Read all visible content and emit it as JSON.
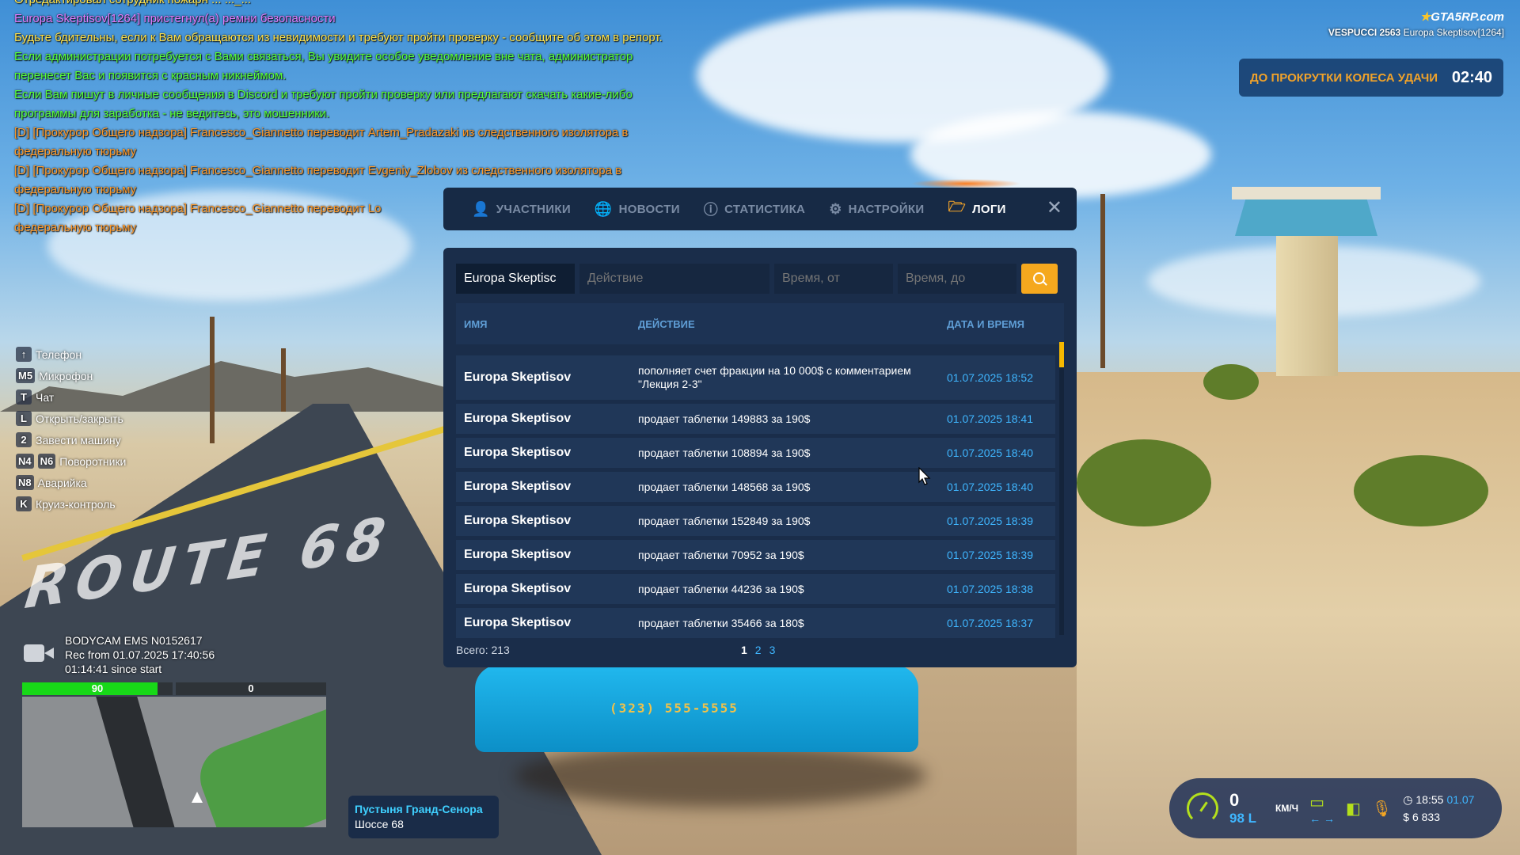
{
  "chat": [
    {
      "text": "Отредактировал сотрудник пожарн ... ..._...",
      "color": "c-yellow",
      "cut": true
    },
    {
      "text": "Europa Skeptisov[1264] пристегнул(а) ремни безопасности",
      "color": "c-purple"
    },
    {
      "text": "Будьте бдительны, если к Вам обращаются из невидимости и требуют пройти проверку - сообщите об этом в репорт.",
      "color": "c-yellow"
    },
    {
      "text": "Если администрации потребуется с Вами связаться, Вы увидите особое уведомление вне чата, администратор",
      "color": "c-green"
    },
    {
      "text": "перенесет Вас и появится с красным никнеймом.",
      "color": "c-green"
    },
    {
      "text": "Если Вам пишут в личные сообщения в Discord и требуют пройти проверку или предлагают скачать какие-либо",
      "color": "c-green"
    },
    {
      "text": "программы для заработка - не ведитесь, это мошенники.",
      "color": "c-green"
    },
    {
      "text": "[D] [Прокурор Общего надзора] Francesco_Giannetto переводит Artem_Pradazaki из следственного изолятора в",
      "color": "c-orange"
    },
    {
      "text": "федеральную тюрьму",
      "color": "c-orange"
    },
    {
      "text": "[D] [Прокурор Общего надзора] Francesco_Giannetto переводит Evgeniy_Zlobov из следственного изолятора в",
      "color": "c-orange"
    },
    {
      "text": "федеральную тюрьму",
      "color": "c-orange"
    },
    {
      "text": "[D] [Прокурор Общего надзора] Francesco_Giannetto переводит Lo",
      "color": "c-orange"
    },
    {
      "text": "федеральную тюрьму",
      "color": "c-orange"
    }
  ],
  "brand": {
    "logo": "GTA5RP.com",
    "server": "VESPUCCI 2563",
    "player": "Europa Skeptisov[1264]"
  },
  "wheel": {
    "label": "ДО ПРОКРУТКИ КОЛЕСА УДАЧИ",
    "time": "02:40"
  },
  "hints": [
    {
      "key": "↑",
      "label": "Телефон"
    },
    {
      "key": "M5",
      "label": "Микрофон"
    },
    {
      "key": "T",
      "label": "Чат"
    },
    {
      "key": "L",
      "label": "Открыть/закрыть"
    },
    {
      "key": "2",
      "label": "Завести машину"
    },
    {
      "key": "N4",
      "key2": "N6",
      "label": "Поворотники"
    },
    {
      "key": "N8",
      "label": "Аварийка"
    },
    {
      "key": "K",
      "label": "Круиз-контроль"
    }
  ],
  "bodycam": {
    "id": "BODYCAM EMS N0152617",
    "rec": "Rec from 01.07.2025 17:40:56",
    "since": "01:14:41 since start"
  },
  "bars": {
    "health": "90",
    "health_fraction": 0.9,
    "armor": "0",
    "armor_fraction": 0
  },
  "location": {
    "zone": "Пустыня Гранд-Сенора",
    "street": "Шоссе 68"
  },
  "hud": {
    "speed": "0",
    "fuel": "98 L",
    "unit": "КМ/Ч",
    "time": "18:55",
    "date": "01.07",
    "money": "6 833"
  },
  "tabs": [
    {
      "label": "УЧАСТНИКИ",
      "icon": "user-icon",
      "glyph": "👤",
      "active": false
    },
    {
      "label": "НОВОСТИ",
      "icon": "globe-icon",
      "glyph": "🌐",
      "active": false
    },
    {
      "label": "СТАТИСТИКА",
      "icon": "info-icon",
      "glyph": "ⓘ",
      "active": false
    },
    {
      "label": "НАСТРОЙКИ",
      "icon": "gear-icon",
      "glyph": "⚙",
      "active": false
    },
    {
      "label": "ЛОГИ",
      "icon": "folder-icon",
      "glyph": "🗁",
      "active": true
    }
  ],
  "filters": {
    "name_value": "Europa Skeptisc",
    "action_placeholder": "Действие",
    "from_placeholder": "Время, от",
    "to_placeholder": "Время, до"
  },
  "table": {
    "headers": {
      "name": "ИМЯ",
      "action": "ДЕЙСТВИЕ",
      "date": "ДАТА И ВРЕМЯ"
    },
    "rows": [
      {
        "name": "Europa Skeptisov",
        "action": "пополняет счет фракции на 10 000$ с комментарием \"Лекция 2-3\"",
        "date": "01.07.2025 18:52",
        "tall": true
      },
      {
        "name": "Europa Skeptisov",
        "action": "продает таблетки 149883 за 190$",
        "date": "01.07.2025 18:41"
      },
      {
        "name": "Europa Skeptisov",
        "action": "продает таблетки 108894 за 190$",
        "date": "01.07.2025 18:40"
      },
      {
        "name": "Europa Skeptisov",
        "action": "продает таблетки 148568 за 190$",
        "date": "01.07.2025 18:40"
      },
      {
        "name": "Europa Skeptisov",
        "action": "продает таблетки 152849 за 190$",
        "date": "01.07.2025 18:39"
      },
      {
        "name": "Europa Skeptisov",
        "action": "продает таблетки 70952 за 190$",
        "date": "01.07.2025 18:39"
      },
      {
        "name": "Europa Skeptisov",
        "action": "продает таблетки 44236 за 190$",
        "date": "01.07.2025 18:38"
      },
      {
        "name": "Europa Skeptisov",
        "action": "продает таблетки 35466 за 180$",
        "date": "01.07.2025 18:37"
      }
    ]
  },
  "footer": {
    "total": "Всего: 213",
    "pages": [
      "1",
      "2",
      "3"
    ],
    "current_page": "1"
  },
  "car_plate": "(323) 555-5555",
  "route_marking": "ROUTE 68"
}
